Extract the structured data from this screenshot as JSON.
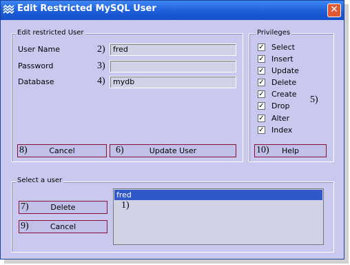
{
  "window": {
    "title": "Edit Restricted MySQL User"
  },
  "edit_section": {
    "legend": "Edit restricted User",
    "fields": [
      {
        "label": "User Name",
        "marker": "2)",
        "value": "fred"
      },
      {
        "label": "Password",
        "marker": "3)",
        "value": ""
      },
      {
        "label": "Database",
        "marker": "4)",
        "value": "mydb"
      }
    ],
    "cancel_button": {
      "marker": "8)",
      "label": "Cancel"
    },
    "update_button": {
      "marker": "6)",
      "label": "Update User"
    }
  },
  "privileges": {
    "legend": "Privileges",
    "items": [
      {
        "label": "Select",
        "checked": true
      },
      {
        "label": "Insert",
        "checked": true
      },
      {
        "label": "Update",
        "checked": true
      },
      {
        "label": "Delete",
        "checked": true
      },
      {
        "label": "Create",
        "checked": true
      },
      {
        "label": "Drop",
        "checked": true
      },
      {
        "label": "Alter",
        "checked": true
      },
      {
        "label": "Index",
        "checked": true
      }
    ],
    "marker": "5)",
    "help_button": {
      "marker": "10)",
      "label": "Help"
    }
  },
  "select_section": {
    "legend": "Select a user",
    "delete_button": {
      "marker": "7)",
      "label": "Delete"
    },
    "cancel_button": {
      "marker": "9)",
      "label": "Cancel"
    },
    "users": [
      "fred"
    ],
    "list_marker": "1)"
  },
  "colors": {
    "titlebar": "#1b5ad7",
    "window_bg": "#c9c9f0",
    "button_border": "#8a1030",
    "selection": "#3058c8"
  },
  "icons": {
    "app": "wave-icon",
    "close": "close-icon"
  }
}
